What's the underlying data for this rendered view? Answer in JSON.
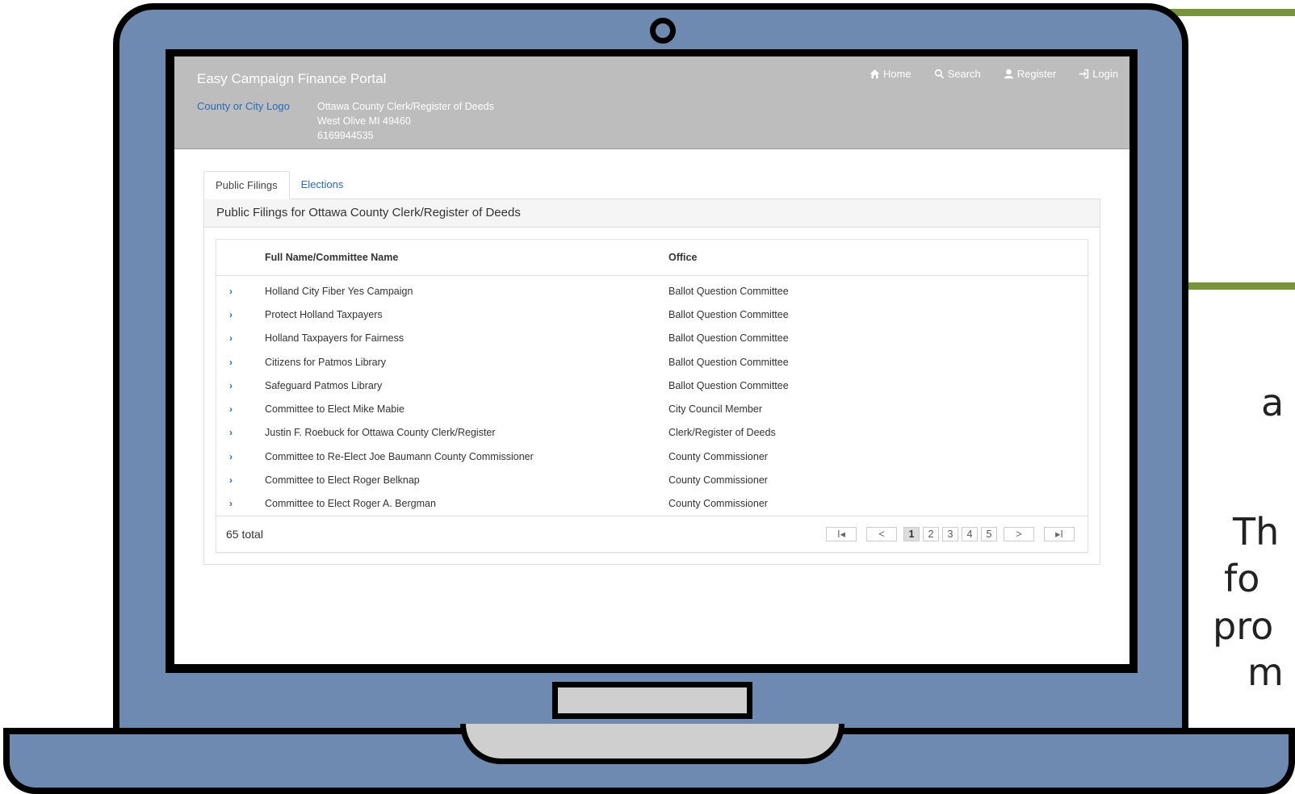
{
  "app": {
    "brand": "Easy Campaign Finance Portal",
    "logo_alt": "County or City Logo",
    "address": [
      "Ottawa County Clerk/Register of Deeds",
      "West Olive MI 49460",
      "6169944535"
    ],
    "nav": [
      {
        "label": "Home",
        "icon": "home-icon"
      },
      {
        "label": "Search",
        "icon": "search-icon"
      },
      {
        "label": "Register",
        "icon": "user-icon"
      },
      {
        "label": "Login",
        "icon": "login-icon"
      }
    ]
  },
  "tabs": [
    {
      "label": "Public Filings",
      "active": true
    },
    {
      "label": "Elections",
      "active": false
    }
  ],
  "panel": {
    "heading": "Public Filings for Ottawa County Clerk/Register of Deeds",
    "columns": {
      "name": "Full Name/Committee Name",
      "office": "Office"
    },
    "expand_glyph": "›",
    "rows": [
      {
        "name": "Holland City Fiber Yes Campaign",
        "office": "Ballot Question Committee"
      },
      {
        "name": "Protect Holland Taxpayers",
        "office": "Ballot Question Committee"
      },
      {
        "name": "Holland Taxpayers for Fairness",
        "office": "Ballot Question Committee"
      },
      {
        "name": "Citizens for Patmos Library",
        "office": "Ballot Question Committee"
      },
      {
        "name": "Safeguard Patmos Library",
        "office": "Ballot Question Committee"
      },
      {
        "name": "Committee to Elect Mike Mabie",
        "office": "City Council Member"
      },
      {
        "name": "Justin F. Roebuck for Ottawa County Clerk/Register",
        "office": "Clerk/Register of Deeds"
      },
      {
        "name": "Committee to Re-Elect Joe Baumann County Commissioner",
        "office": "County Commissioner"
      },
      {
        "name": "Committee to Elect Roger Belknap",
        "office": "County Commissioner"
      },
      {
        "name": "Committee to Elect Roger A. Bergman",
        "office": "County Commissioner"
      }
    ],
    "total": "65 total",
    "pager": {
      "first": "I◂",
      "prev": "<",
      "pages": [
        "1",
        "2",
        "3",
        "4",
        "5"
      ],
      "current": "1",
      "next": ">",
      "last": "▸I"
    }
  },
  "slide_fragments": [
    "a",
    "Th",
    "fo",
    "pro",
    "m"
  ],
  "colors": {
    "laptop_body": "#6f8ab0",
    "accent_line": "#77933c",
    "header_bg": "#bdbdbd",
    "link": "#2a6db5"
  }
}
